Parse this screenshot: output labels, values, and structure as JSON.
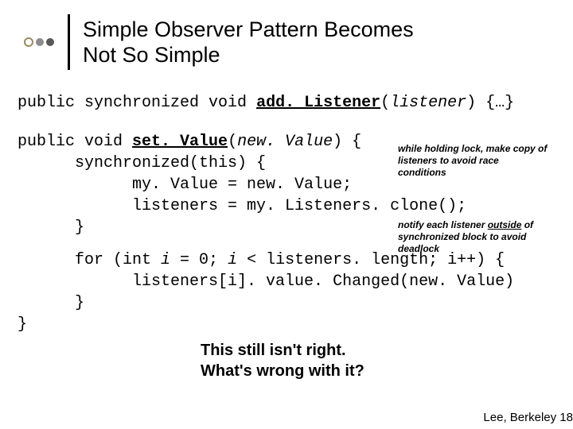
{
  "title": {
    "line1": "Simple Observer Pattern Becomes",
    "line2": "Not So Simple"
  },
  "code": {
    "l1_a": "public synchronized void ",
    "l1_b": "add. Listener",
    "l1_c": "(",
    "l1_d": "listener",
    "l1_e": ") {…}",
    "l2_a": "public void ",
    "l2_b": "set. Value",
    "l2_c": "(",
    "l2_d": "new. Value",
    "l2_e": ") {",
    "l3": "      synchronized(this) {",
    "l4": "            my. Value = new. Value;",
    "l5": "            listeners = my. Listeners. clone();",
    "l6": "      }",
    "l7a": "      for (int ",
    "l7b": "i",
    "l7c": " = 0; ",
    "l7d": "i",
    "l7e": " < listeners. length; i++) {",
    "l8": "            listeners[i]. value. Changed(new. Value)",
    "l9": "      }",
    "l10": "}"
  },
  "notes": {
    "n1": "while holding lock, make copy of listeners to avoid race conditions",
    "n2_a": "notify each listener ",
    "n2_b": "outside",
    "n2_c": " of synchronized block to avoid deadlock"
  },
  "question": {
    "q1": "This still isn't right.",
    "q2": "What's wrong with it?"
  },
  "footer": "Lee, Berkeley 18"
}
